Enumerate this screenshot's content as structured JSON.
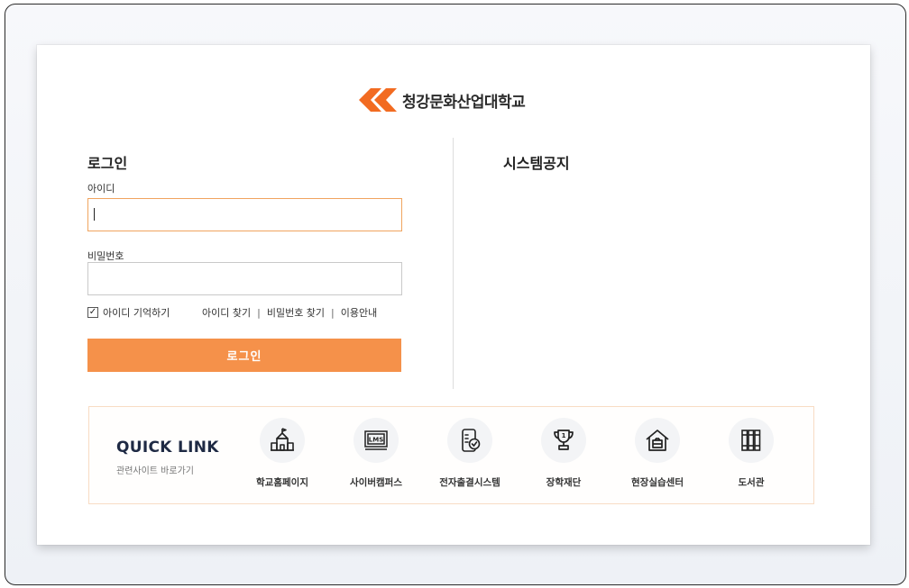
{
  "logo": {
    "name": "청강문화산업대학교",
    "accent_color": "#f26b21"
  },
  "login": {
    "title": "로그인",
    "id_label": "아이디",
    "id_value": "",
    "pw_label": "비밀번호",
    "pw_value": "",
    "remember_label": "아이디 기억하기",
    "remember_checked": true,
    "links": [
      "아이디 찾기",
      "비밀번호 찾기",
      "이용안내"
    ],
    "submit_label": "로그인",
    "button_color": "#f5914a"
  },
  "notice": {
    "title": "시스템공지"
  },
  "quick_link": {
    "title": "QUICK LINK",
    "subtitle": "관련사이트 바로가기",
    "items": [
      {
        "label": "학교홈페이지",
        "icon": "school-building-icon"
      },
      {
        "label": "사이버캠퍼스",
        "icon": "lms-monitor-icon"
      },
      {
        "label": "전자출결시스템",
        "icon": "attendance-phone-icon"
      },
      {
        "label": "장학재단",
        "icon": "trophy-icon"
      },
      {
        "label": "현장실습센터",
        "icon": "house-briefcase-icon"
      },
      {
        "label": "도서관",
        "icon": "books-icon"
      }
    ]
  }
}
